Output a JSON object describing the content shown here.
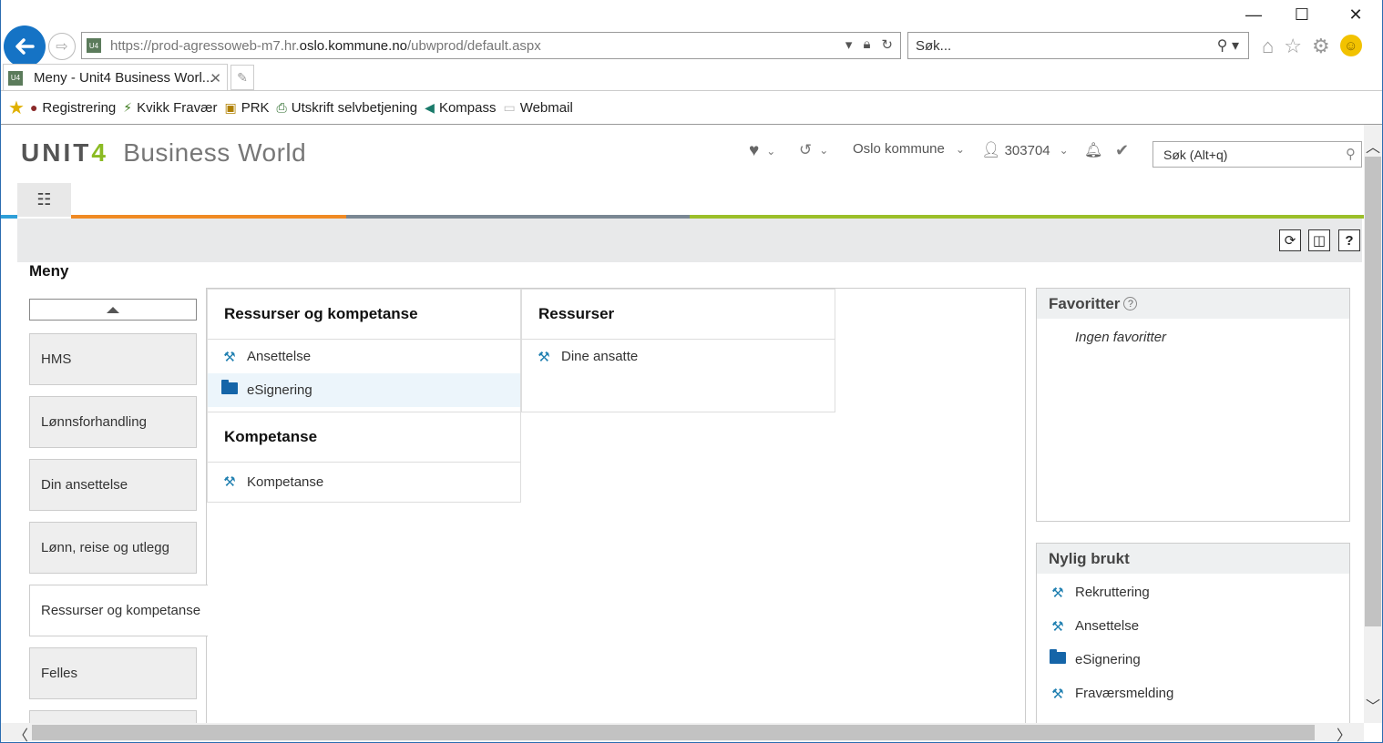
{
  "browser": {
    "window_controls": {
      "minimize": "—",
      "maximize": "☐",
      "close": "✕"
    },
    "address": {
      "url_prefix": "https://prod-agressoweb-m7.hr.",
      "url_domain": "oslo.kommune.no",
      "url_suffix": "/ubwprod/default.aspx",
      "favicon_text": "U4"
    },
    "search_box": {
      "placeholder": "Søk..."
    },
    "tab": {
      "title": "Meny - Unit4 Business Worl...",
      "close": "✕",
      "favicon_text": "U4"
    },
    "favorites_bar": [
      {
        "label": "Registrering",
        "icon": "owl-icon"
      },
      {
        "label": "Kvikk Fravær",
        "icon": "running-icon"
      },
      {
        "label": "PRK",
        "icon": "prk-icon"
      },
      {
        "label": "Utskrift selvbetjening",
        "icon": "printer-icon"
      },
      {
        "label": "Kompass",
        "icon": "kompass-icon"
      },
      {
        "label": "Webmail",
        "icon": "page-icon"
      }
    ]
  },
  "app": {
    "logo": {
      "brand": "UNIT",
      "brand_four": "4",
      "product": "Business World"
    },
    "topnav": {
      "org": "Oslo kommune",
      "user_id": "303704"
    },
    "search": {
      "placeholder": "Søk (Alt+q)"
    },
    "menu_tab_icon": "list-icon",
    "stripe_colors": [
      "#2e9fd8",
      "#f08a24",
      "#7a8793",
      "#9bbf2a"
    ],
    "page_title": "Meny",
    "left_menu": {
      "items": [
        {
          "label": "HMS",
          "active": false
        },
        {
          "label": "Lønnsforhandling",
          "active": false
        },
        {
          "label": "Din ansettelse",
          "active": false
        },
        {
          "label": "Lønn, reise og utlegg",
          "active": false
        },
        {
          "label": "Ressurser og kompetanse",
          "active": true
        },
        {
          "label": "Felles",
          "active": false
        }
      ]
    },
    "columns": [
      {
        "title": "Ressurser og kompetanse",
        "items": [
          {
            "label": "Ansettelse",
            "icon": "tools-icon"
          },
          {
            "label": "eSignering",
            "icon": "folder-icon",
            "highlighted": true
          }
        ]
      },
      {
        "title": "Ressurser",
        "items": [
          {
            "label": "Dine ansatte",
            "icon": "tools-icon"
          }
        ]
      },
      {
        "title": "Kompetanse",
        "items": [
          {
            "label": "Kompetanse",
            "icon": "tools-icon"
          }
        ]
      }
    ],
    "favorites_panel": {
      "title": "Favoritter",
      "help": "?",
      "empty_text": "Ingen favoritter"
    },
    "recent_panel": {
      "title": "Nylig brukt",
      "items": [
        {
          "label": "Rekruttering",
          "icon": "tools-icon"
        },
        {
          "label": "Ansettelse",
          "icon": "tools-icon"
        },
        {
          "label": "eSignering",
          "icon": "folder-icon"
        },
        {
          "label": "Fraværsmelding",
          "icon": "tools-icon"
        }
      ]
    }
  }
}
